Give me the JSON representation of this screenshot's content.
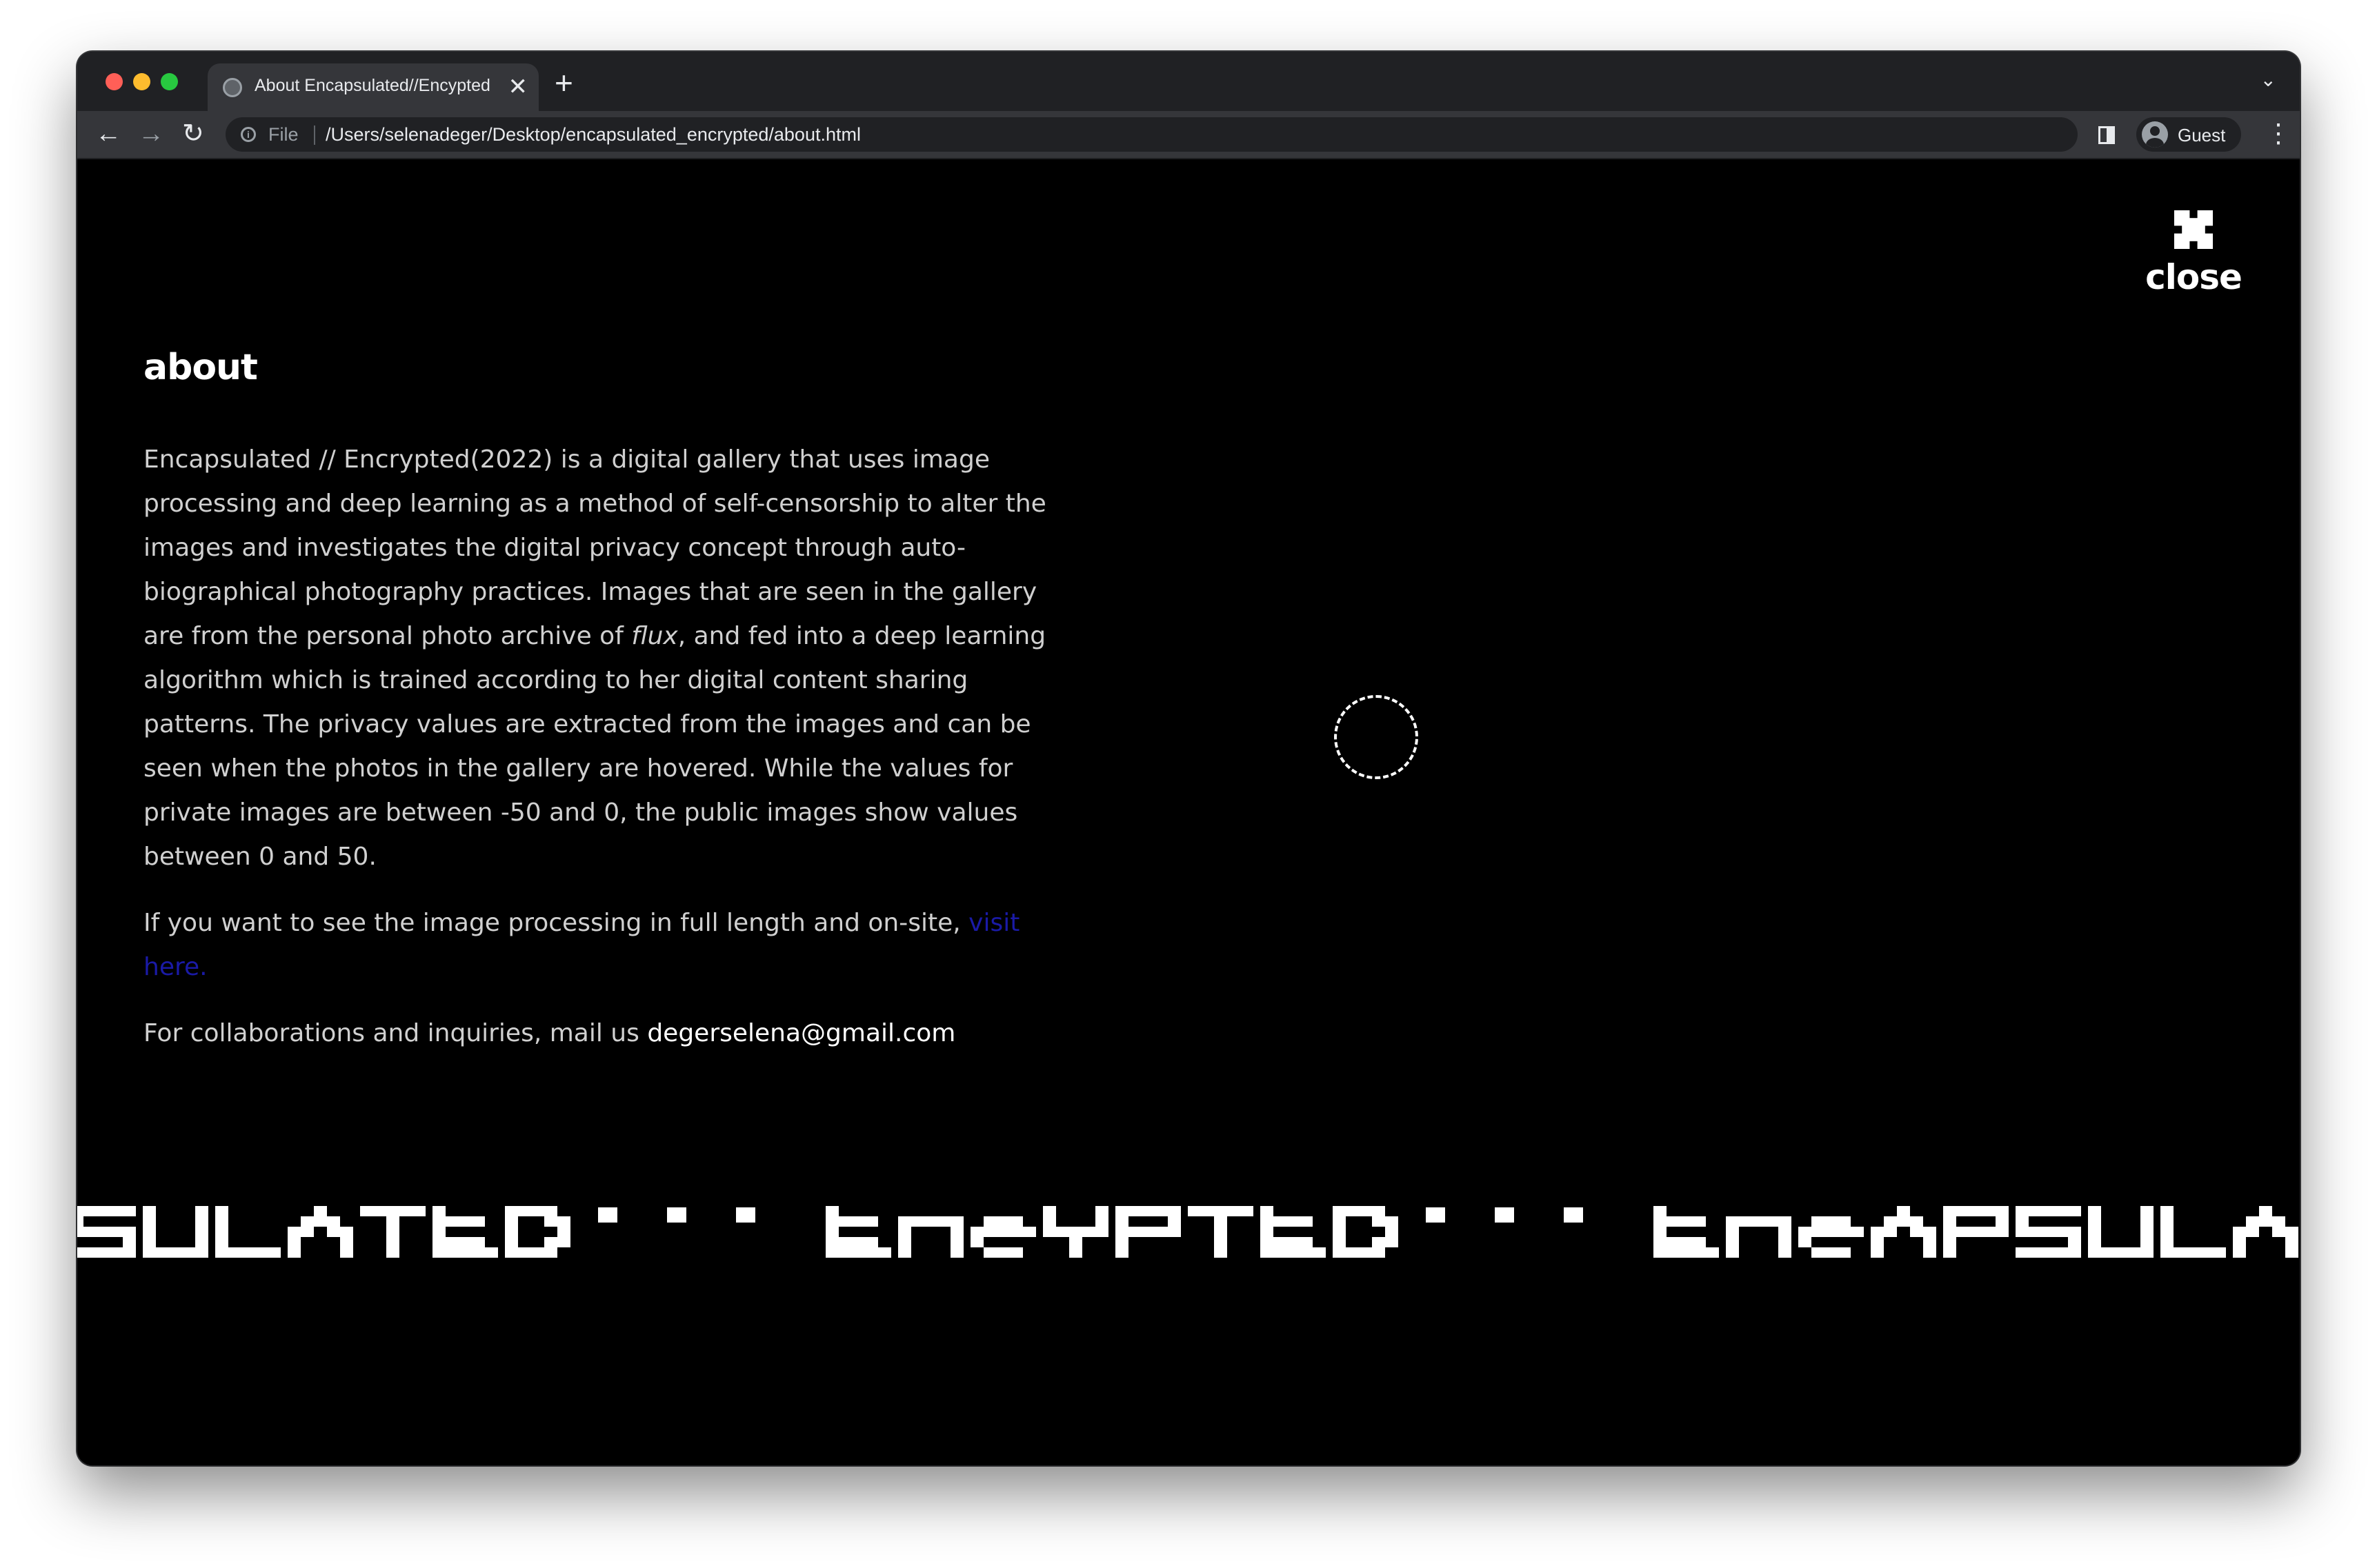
{
  "browser": {
    "tab_title": "About Encapsulated//Encypted",
    "tab_close_glyph": "✕",
    "new_tab_glyph": "+",
    "tab_search_glyph": "⌄",
    "nav": {
      "back": "←",
      "forward": "→",
      "reload": "↻"
    },
    "address": {
      "info_glyph": "i",
      "scheme_label": "File",
      "url": "/Users/selenadeger/Desktop/encapsulated_encrypted/about.html"
    },
    "profile_label": "Guest",
    "menu_glyph": "⋮"
  },
  "page": {
    "close_label": "close",
    "title": "about",
    "paragraph1_before_em": "Encapsulated // Encrypted(2022) is a digital gallery that uses image processing and deep learning as a method of self-censorship to alter the images and investigates the digital privacy concept through auto-biographical photography practices. Images that are seen in the gallery are from the personal photo archive of ",
    "paragraph1_em": "flux",
    "paragraph1_after_em": ", and fed into a deep learning algorithm which is trained according to her digital content sharing patterns. The privacy values are extracted from the images and can be seen when the photos in the gallery are hovered. While the values for private images are between -50 and 0, the public images show values between 0 and 50.",
    "paragraph2_text": "If you want to see the image processing in full length and on-site, ",
    "paragraph2_link": "visit here.",
    "paragraph3_text": "For collaborations and inquiries, mail us ",
    "paragraph3_email": "degerselena@gmail.com"
  },
  "colors": {
    "page_background": "#000000",
    "text": "#d0d0d0",
    "link": "#1a1aa6",
    "chrome_tabstrip": "#202124",
    "chrome_toolbar": "#35363a"
  }
}
